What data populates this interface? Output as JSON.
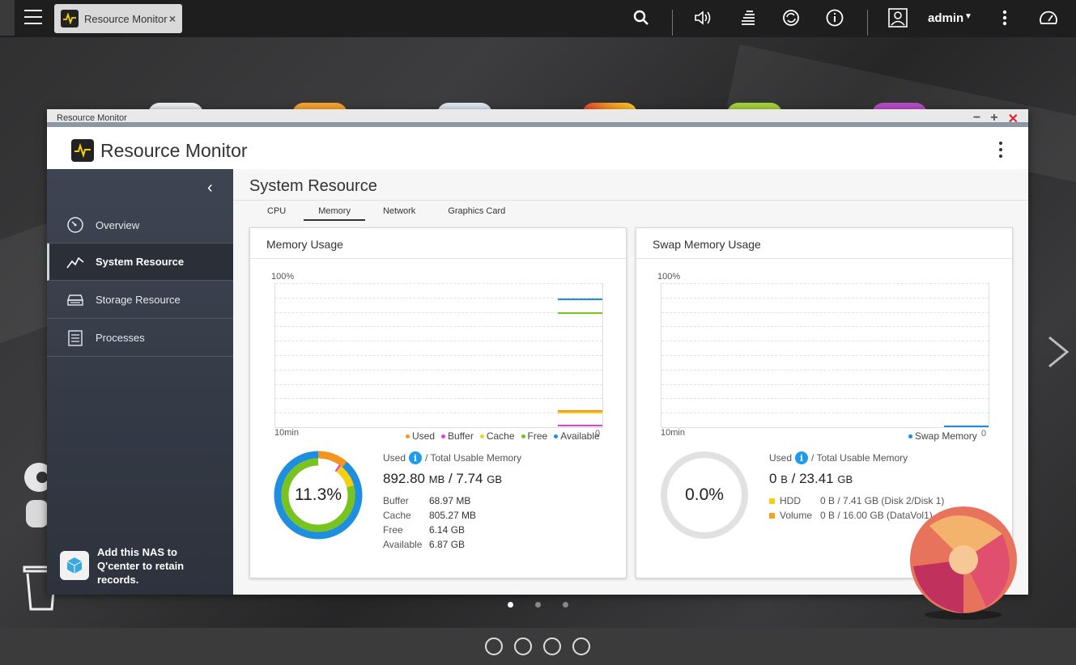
{
  "topbar": {
    "app_tab_label": "Resource Monitor",
    "user": "admin"
  },
  "window": {
    "title": "Resource Monitor",
    "app_name": "Resource Monitor"
  },
  "sidebar": {
    "items": [
      {
        "label": "Overview",
        "icon": "gauge-icon"
      },
      {
        "label": "System Resource",
        "icon": "line-chart-icon",
        "active": true
      },
      {
        "label": "Storage Resource",
        "icon": "storage-icon"
      },
      {
        "label": "Processes",
        "icon": "list-icon"
      }
    ],
    "qcenter_text": "Add this NAS to Q'center to retain records."
  },
  "main": {
    "page_title": "System Resource",
    "tabs": [
      "CPU",
      "Memory",
      "Network",
      "Graphics Card"
    ],
    "active_tab": "Memory"
  },
  "memory_card": {
    "title": "Memory Usage",
    "y_max_label": "100%",
    "x_label": "10min",
    "zero_label": "0",
    "legend": [
      {
        "label": "Used",
        "color": "#f7941d"
      },
      {
        "label": "Buffer",
        "color": "#e33fe0"
      },
      {
        "label": "Cache",
        "color": "#f5d10c"
      },
      {
        "label": "Free",
        "color": "#79c31e"
      },
      {
        "label": "Available",
        "color": "#1e8fde"
      }
    ],
    "donut_percent": "11.3%",
    "used_label": "Used",
    "total_label": "/ Total Usable Memory",
    "used_value": "892.80",
    "used_unit": "MB",
    "total_value": "7.74",
    "total_unit": "GB",
    "details": [
      {
        "k": "Buffer",
        "v": "68.97 MB"
      },
      {
        "k": "Cache",
        "v": "805.27 MB"
      },
      {
        "k": "Free",
        "v": "6.14 GB"
      },
      {
        "k": "Available",
        "v": "6.87 GB"
      }
    ]
  },
  "swap_card": {
    "title": "Swap Memory Usage",
    "y_max_label": "100%",
    "x_label": "10min",
    "zero_label": "0",
    "legend_label": "Swap Memory",
    "legend_color": "#1e8fde",
    "donut_percent": "0.0%",
    "used_label": "Used",
    "total_label": "/ Total Usable Memory",
    "used_value": "0",
    "used_unit": "B",
    "total_value": "23.41",
    "total_unit": "GB",
    "details": [
      {
        "k": "HDD",
        "v": "0 B / 7.41 GB (Disk 2/Disk 1)",
        "color": "#f5d10c"
      },
      {
        "k": "Volume",
        "v": "0 B / 16.00 GB (DataVol1)",
        "color": "#f7a21d"
      }
    ]
  },
  "chart_data": [
    {
      "type": "line",
      "title": "Memory Usage",
      "xlabel": "10min",
      "ylabel": "",
      "ylim": [
        0,
        100
      ],
      "series": [
        {
          "name": "Available",
          "color": "#1e8fde",
          "values": [
            88.8
          ]
        },
        {
          "name": "Free",
          "color": "#79c31e",
          "values": [
            79.3
          ]
        },
        {
          "name": "Used",
          "color": "#f7941d",
          "values": [
            11.3
          ]
        },
        {
          "name": "Cache",
          "color": "#f5d10c",
          "values": [
            10.2
          ]
        },
        {
          "name": "Buffer",
          "color": "#e33fe0",
          "values": [
            0.9
          ]
        }
      ]
    },
    {
      "type": "line",
      "title": "Swap Memory Usage",
      "xlabel": "10min",
      "ylim": [
        0,
        100
      ],
      "series": [
        {
          "name": "Swap Memory",
          "color": "#1e8fde",
          "values": [
            0
          ]
        }
      ]
    }
  ]
}
